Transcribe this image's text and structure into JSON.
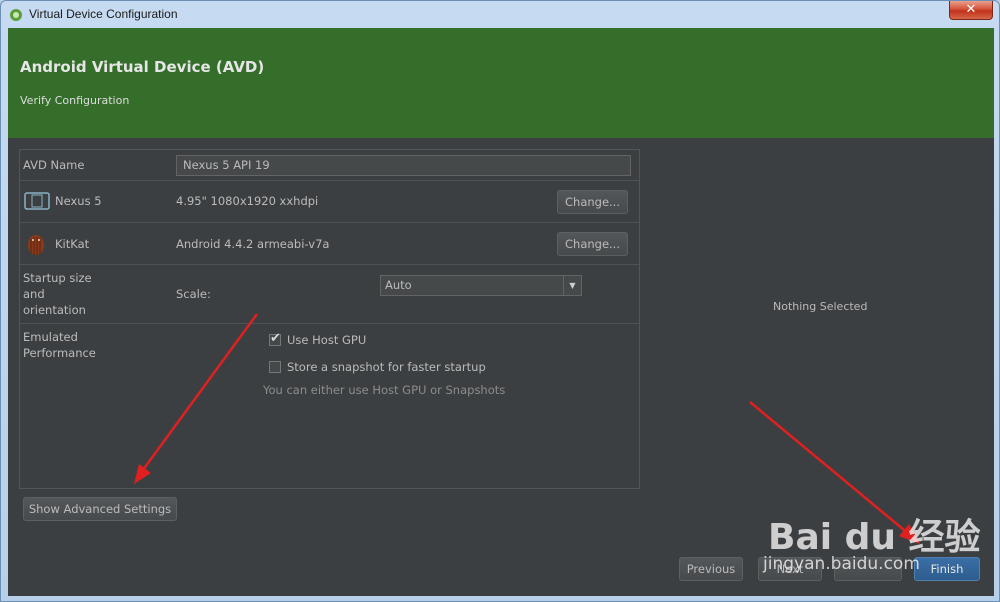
{
  "window": {
    "title": "Virtual Device Configuration",
    "close_label": "✕"
  },
  "header": {
    "title": "Android Virtual Device (AVD)",
    "subtitle": "Verify Configuration"
  },
  "form": {
    "avd_name": {
      "label": "AVD Name",
      "value": "Nexus 5 API 19"
    },
    "device": {
      "label": "Nexus 5",
      "spec": "4.95\" 1080x1920 xxhdpi",
      "change_label": "Change..."
    },
    "system_image": {
      "label": "KitKat",
      "spec": "Android 4.4.2 armeabi-v7a",
      "change_label": "Change..."
    },
    "startup": {
      "label_line1": "Startup size",
      "label_line2": "and",
      "label_line3": "orientation",
      "scale_label": "Scale:",
      "scale_value": "Auto"
    },
    "performance": {
      "label_line1": "Emulated",
      "label_line2": "Performance",
      "use_host_gpu": {
        "label": "Use Host GPU",
        "checked": true
      },
      "snapshot": {
        "label": "Store a snapshot for faster startup",
        "checked": false
      },
      "hint": "You can either use Host GPU or Snapshots"
    }
  },
  "right_panel": {
    "empty_text": "Nothing Selected"
  },
  "buttons": {
    "advanced": "Show Advanced Settings",
    "previous": "Previous",
    "next": "Next",
    "finish": "Finish"
  },
  "watermark": {
    "logo": "Bai du 经验",
    "url": "jingyan.baidu.com"
  },
  "colors": {
    "header_green": "#356e2b",
    "panel_bg": "#3c3f41",
    "annotation_red": "#e02020"
  }
}
